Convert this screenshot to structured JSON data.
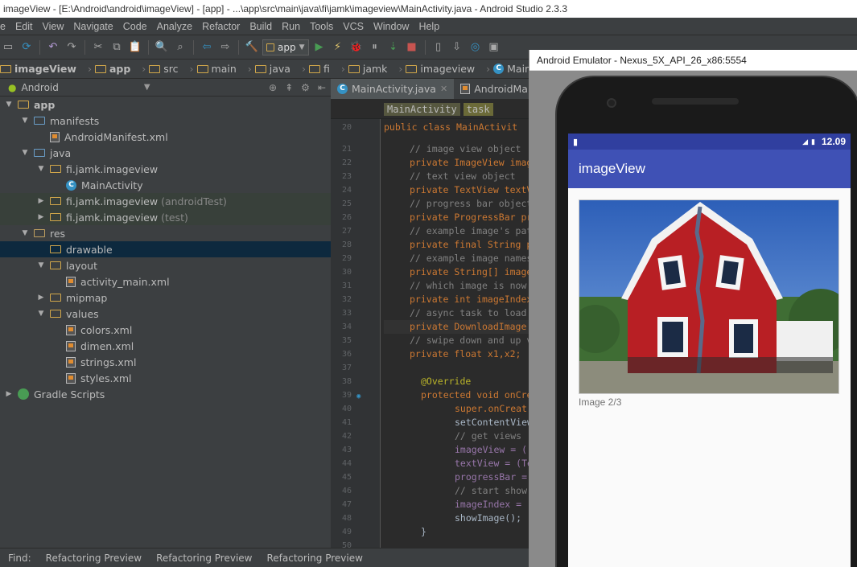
{
  "window_title": "imageView - [E:\\Android\\android\\imageView] - [app] - ...\\app\\src\\main\\java\\fi\\jamk\\imageview\\MainActivity.java - Android Studio 2.3.3",
  "menu": [
    "e",
    "Edit",
    "View",
    "Navigate",
    "Code",
    "Analyze",
    "Refactor",
    "Build",
    "Run",
    "Tools",
    "VCS",
    "Window",
    "Help"
  ],
  "toolbar": {
    "run_config": "app"
  },
  "breadcrumbs": [
    "imageView",
    "app",
    "src",
    "main",
    "java",
    "fi",
    "jamk",
    "imageview",
    "MainActivity"
  ],
  "project_view": {
    "mode": "Android"
  },
  "tree": [
    {
      "label": "app",
      "extra": "",
      "indent": 0,
      "arrow": "down",
      "icon": "module"
    },
    {
      "label": "manifests",
      "extra": "",
      "indent": 1,
      "arrow": "down",
      "icon": "folder-blue"
    },
    {
      "label": "AndroidManifest.xml",
      "extra": "",
      "indent": 2,
      "arrow": "",
      "icon": "xml"
    },
    {
      "label": "java",
      "extra": "",
      "indent": 1,
      "arrow": "down",
      "icon": "folder-blue"
    },
    {
      "label": "fi.jamk.imageview",
      "extra": "",
      "indent": 2,
      "arrow": "down",
      "icon": "package"
    },
    {
      "label": "MainActivity",
      "extra": "",
      "indent": 3,
      "arrow": "",
      "icon": "class"
    },
    {
      "label": "fi.jamk.imageview",
      "extra": "(androidTest)",
      "indent": 2,
      "arrow": "right",
      "icon": "package",
      "style": "test"
    },
    {
      "label": "fi.jamk.imageview",
      "extra": "(test)",
      "indent": 2,
      "arrow": "right",
      "icon": "package",
      "style": "test"
    },
    {
      "label": "res",
      "extra": "",
      "indent": 1,
      "arrow": "down",
      "icon": "folder-res"
    },
    {
      "label": "drawable",
      "extra": "",
      "indent": 2,
      "arrow": "",
      "icon": "package",
      "style": "sel"
    },
    {
      "label": "layout",
      "extra": "",
      "indent": 2,
      "arrow": "down",
      "icon": "package"
    },
    {
      "label": "activity_main.xml",
      "extra": "",
      "indent": 3,
      "arrow": "",
      "icon": "xml"
    },
    {
      "label": "mipmap",
      "extra": "",
      "indent": 2,
      "arrow": "right",
      "icon": "package"
    },
    {
      "label": "values",
      "extra": "",
      "indent": 2,
      "arrow": "down",
      "icon": "package"
    },
    {
      "label": "colors.xml",
      "extra": "",
      "indent": 3,
      "arrow": "",
      "icon": "xml"
    },
    {
      "label": "dimen.xml",
      "extra": "",
      "indent": 3,
      "arrow": "",
      "icon": "xml"
    },
    {
      "label": "strings.xml",
      "extra": "",
      "indent": 3,
      "arrow": "",
      "icon": "xml"
    },
    {
      "label": "styles.xml",
      "extra": "",
      "indent": 3,
      "arrow": "",
      "icon": "xml"
    },
    {
      "label": "Gradle Scripts",
      "extra": "",
      "indent": 0,
      "arrow": "right",
      "icon": "gradle"
    }
  ],
  "editor_tabs": [
    {
      "label": "MainActivity.java",
      "active": true
    },
    {
      "label": "AndroidManife",
      "active": false
    }
  ],
  "editor_breadcrumbs": [
    "MainActivity",
    "task"
  ],
  "code_lines": [
    {
      "n": "20",
      "text": "public class MainActivit",
      "cls": "kw",
      "indent": 0
    },
    {
      "n": "21",
      "text": "// image view object",
      "cls": "cmt",
      "indent": 1
    },
    {
      "n": "22",
      "text": "private ImageView imag",
      "cls": "mix",
      "indent": 1
    },
    {
      "n": "23",
      "text": "// text view object",
      "cls": "cmt",
      "indent": 1
    },
    {
      "n": "24",
      "text": "private TextView textV",
      "cls": "mix",
      "indent": 1
    },
    {
      "n": "25",
      "text": "// progress bar object",
      "cls": "cmt",
      "indent": 1
    },
    {
      "n": "26",
      "text": "private ProgressBar pr",
      "cls": "mix",
      "indent": 1
    },
    {
      "n": "27",
      "text": "// example image's pat",
      "cls": "cmt",
      "indent": 1
    },
    {
      "n": "28",
      "text": "private final String p",
      "cls": "mix",
      "indent": 1
    },
    {
      "n": "29",
      "text": "// example image names",
      "cls": "cmt",
      "indent": 1
    },
    {
      "n": "30",
      "text": "private String[] image",
      "cls": "mix",
      "indent": 1
    },
    {
      "n": "31",
      "text": "// which image is now",
      "cls": "cmt",
      "indent": 1
    },
    {
      "n": "32",
      "text": "private int imageIndex",
      "cls": "mix",
      "indent": 1
    },
    {
      "n": "33",
      "text": "// async task to load",
      "cls": "cmt",
      "indent": 1
    },
    {
      "n": "34",
      "text": "private DownloadImage",
      "cls": "mix",
      "indent": 1,
      "hl": true
    },
    {
      "n": "35",
      "text": "// swipe down and up v",
      "cls": "cmt",
      "indent": 1
    },
    {
      "n": "36",
      "text": "private float x1,x2;",
      "cls": "mix",
      "indent": 1
    },
    {
      "n": "37",
      "text": "",
      "cls": "pln",
      "indent": 1
    },
    {
      "n": "38",
      "text": "@Override",
      "cls": "ann",
      "indent": 2
    },
    {
      "n": "39",
      "text": "protected void onCre",
      "cls": "mix",
      "indent": 2
    },
    {
      "n": "40",
      "text": "super.onCreat",
      "cls": "kwpln",
      "indent": 3
    },
    {
      "n": "41",
      "text": "setContentView",
      "cls": "pln",
      "indent": 3
    },
    {
      "n": "42",
      "text": "// get views",
      "cls": "cmt",
      "indent": 3
    },
    {
      "n": "43",
      "text": "imageView = (",
      "cls": "fld",
      "indent": 3
    },
    {
      "n": "44",
      "text": "textView = (Te",
      "cls": "fld",
      "indent": 3
    },
    {
      "n": "45",
      "text": "progressBar =",
      "cls": "fld",
      "indent": 3
    },
    {
      "n": "46",
      "text": "// start show",
      "cls": "cmt",
      "indent": 3
    },
    {
      "n": "47",
      "text": "imageIndex =",
      "cls": "fld",
      "indent": 3
    },
    {
      "n": "48",
      "text": "showImage();",
      "cls": "pln",
      "indent": 3
    },
    {
      "n": "49",
      "text": "}",
      "cls": "pln",
      "indent": 2
    },
    {
      "n": "50",
      "text": "",
      "cls": "pln",
      "indent": 1
    }
  ],
  "bottom_tools": [
    "Find:",
    "Refactoring Preview",
    "Refactoring Preview",
    "Refactoring Preview"
  ],
  "emulator": {
    "title": "Android Emulator - Nexus_5X_API_26_x86:5554",
    "clock": "12.09",
    "app_title": "imageView",
    "caption": "Image 2/3"
  },
  "colors": {
    "ide_bg": "#3c3f41",
    "editor_bg": "#2b2b2b",
    "app_bar": "#3f51b5",
    "status_bar": "#303f9f"
  }
}
